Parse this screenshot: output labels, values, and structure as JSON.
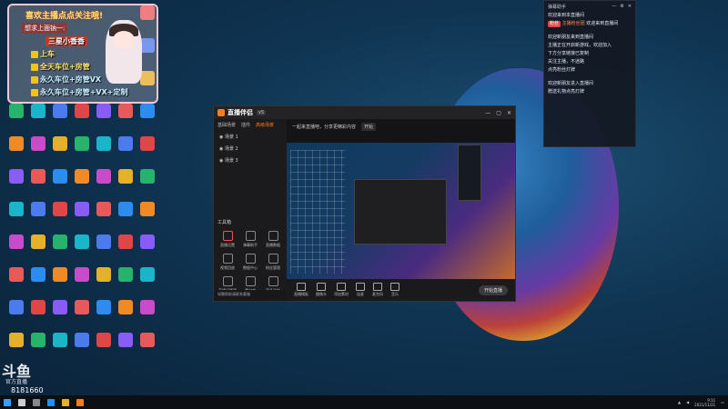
{
  "promo": {
    "title": "喜欢主播点点关注哦!",
    "subtitle": "想求上面钠一:",
    "lines": [
      {
        "text": "三星小香香",
        "color": "#ffffff"
      },
      {
        "text": "上车",
        "color": "#ffe36e"
      },
      {
        "text": "全天车位+房管",
        "color": "#ffe36e"
      },
      {
        "text": "永久车位+房管VX",
        "color": "#c9f2ff"
      },
      {
        "text": "永久车位+房管+VX+定制",
        "color": "#c9f2ff"
      }
    ]
  },
  "app": {
    "brand": "直播伴侣",
    "version": "v5",
    "tabs": [
      "基础场景",
      "插件",
      "高级场景"
    ],
    "scenes": [
      "◉ 场景 1",
      "◉ 场景 2",
      "◉ 场景 3"
    ],
    "tools_title": "工具箱",
    "tools": [
      "直播设置",
      "弹幕助手",
      "直播数据",
      "视频回放",
      "数据中心",
      "粉丝管理",
      "直播间管理",
      "素材库",
      "更多功能"
    ],
    "top_hint": "一起来直播吧，分享更精彩内容",
    "top_pill": "开始",
    "notice": "如需帮助请联系客服",
    "bottom_buttons": [
      "直播模板",
      "摄像头",
      "添加素材",
      "连麦",
      "麦克风",
      "音乐"
    ],
    "go_live": "开始直播"
  },
  "chat": {
    "title": "弹幕助手",
    "messages": [
      {
        "text": "欢迎来到本直播间"
      },
      {
        "badge": "粉丝",
        "badge_color": "red",
        "user": "主播粉丝团",
        "text": "欢迎来到直播间"
      },
      {
        "text": ""
      },
      {
        "text": "欢迎新朋友来到直播间"
      },
      {
        "text": "主播正在开启新游戏，欢迎加入"
      },
      {
        "text": "下方分享链接已复制"
      },
      {
        "text": "关注主播，不迷路"
      },
      {
        "text": "点亮粉丝灯牌"
      },
      {
        "text": ""
      },
      {
        "text": "欢迎新朋友进入直播间"
      },
      {
        "text": "赠送礼物点亮灯牌"
      }
    ]
  },
  "watermark": {
    "logo": "斗鱼",
    "tag": "官方直播",
    "room": "8181660"
  },
  "taskbar": {
    "time": "9:11",
    "date": "2021/11/21"
  }
}
